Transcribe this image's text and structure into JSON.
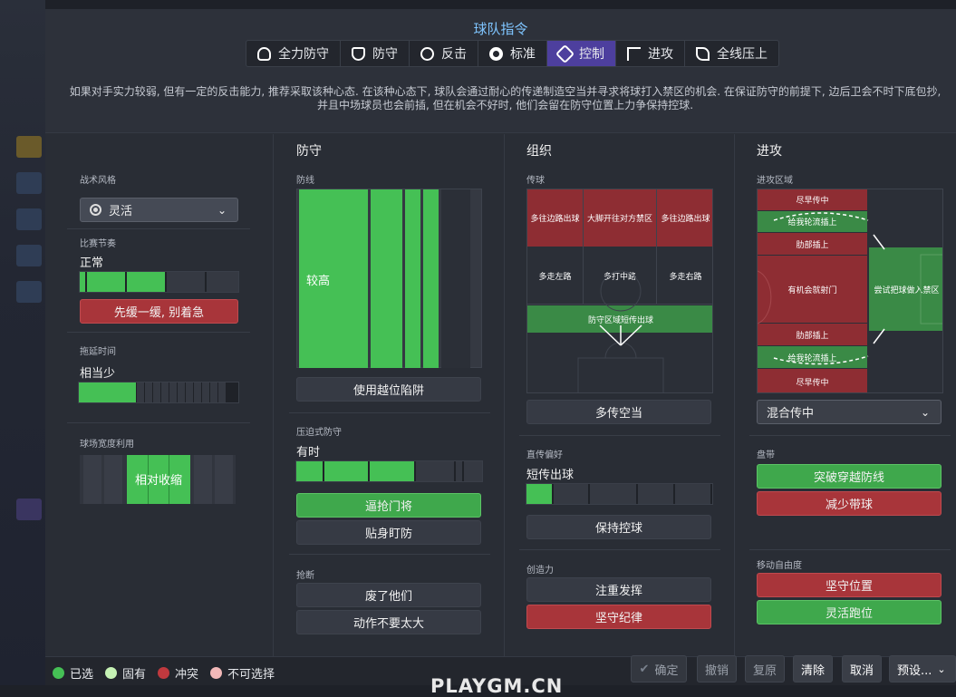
{
  "title": "球队指令",
  "mentality_tabs": [
    {
      "label": "全力防守",
      "icon": "shield-double-icon"
    },
    {
      "label": "防守",
      "icon": "shield-icon"
    },
    {
      "label": "反击",
      "icon": "counter-icon"
    },
    {
      "label": "标准",
      "icon": "balance-icon"
    },
    {
      "label": "控制",
      "icon": "control-icon",
      "active": true
    },
    {
      "label": "进攻",
      "icon": "attack-icon"
    },
    {
      "label": "全线压上",
      "icon": "all-out-icon"
    }
  ],
  "description": "如果对手实力较弱, 但有一定的反击能力, 推荐采取该种心态. 在该种心态下, 球队会通过耐心的传递制造空当并寻求将球打入禁区的机会. 在保证防守的前提下, 边后卫会不时下底包抄, 并且中场球员也会前插, 但在机会不好时, 他们会留在防守位置上力争保持控球.",
  "general": {
    "style_label": "战术风格",
    "style_value": "灵活",
    "tempo_label": "比赛节奏",
    "tempo_value": "正常",
    "tempo_level": 0.5,
    "tempo_button": "先缓一缓, 别着急",
    "timewasting_label": "拖延时间",
    "timewasting_value": "相当少",
    "timewasting_level": 0.35,
    "width_label": "球场宽度利用",
    "width_value": "相对收缩"
  },
  "defense": {
    "header": "防守",
    "line_label": "防线",
    "line_value": "较高",
    "offside_button": "使用越位陷阱",
    "press_label": "压迫式防守",
    "press_value": "有时",
    "press_level": 0.6,
    "press_buttons": [
      "逼抢门将",
      "贴身盯防"
    ],
    "tackle_label": "抢断",
    "tackle_buttons": [
      "废了他们",
      "动作不要太大"
    ]
  },
  "organize": {
    "header": "组织",
    "pass_label": "传球",
    "pass_cells_red": [
      "多往边路出球",
      "大脚开往对方禁区",
      "多往边路出球"
    ],
    "pass_cells_mid": [
      "多走左路",
      "多打中路",
      "多走右路"
    ],
    "pass_cell_green": "防守区域短传出球",
    "pass_button": "多传空当",
    "direct_label": "直传偏好",
    "direct_value": "短传出球",
    "direct_level": 0.15,
    "keep_button": "保持控球",
    "creative_label": "创造力",
    "creative_buttons": [
      "注重发挥",
      "坚守纪律"
    ]
  },
  "attack": {
    "header": "进攻",
    "zone_label": "进攻区域",
    "zone_cells": [
      "尽早传中",
      "给我轮流插上",
      "肋部插上",
      "有机会就射门",
      "肋部插上",
      "给我轮流插上",
      "尽早传中"
    ],
    "zone_right": "尝试把球做入禁区",
    "cross_select": "混合传中",
    "dribble_label": "盘带",
    "dribble_buttons": [
      "突破穿越防线",
      "减少带球"
    ],
    "freedom_label": "移动自由度",
    "freedom_buttons": [
      "坚守位置",
      "灵活跑位"
    ]
  },
  "legend": [
    {
      "label": "已选",
      "color": "#45c055"
    },
    {
      "label": "固有",
      "color": "#c6f2b5"
    },
    {
      "label": "冲突",
      "color": "#c0393e"
    },
    {
      "label": "不可选择",
      "color": "#f2b8b8"
    }
  ],
  "footer_buttons": [
    "确定",
    "撤销",
    "复原",
    "清除",
    "取消",
    "预设..."
  ],
  "watermark": "PLAYGM.CN"
}
